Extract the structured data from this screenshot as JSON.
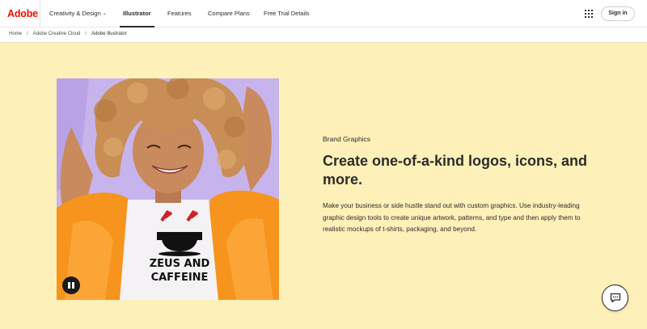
{
  "header": {
    "logo": "Adobe",
    "nav": [
      {
        "label": "Creativity & Design",
        "has_dropdown": true
      },
      {
        "label": "Illustrator",
        "active": true
      },
      {
        "label": "Features"
      },
      {
        "label": "Compare Plans"
      },
      {
        "label": "Free Trial Details"
      }
    ],
    "apps_icon": "grid-icon",
    "signin_label": "Sign in"
  },
  "breadcrumb": {
    "items": [
      "Home",
      "Adobe Creative Cloud",
      "Adobe Illustrator"
    ],
    "separator": "/"
  },
  "hero": {
    "eyebrow": "Brand Graphics",
    "headline": "Create one-of-a-kind logos, icons, and more.",
    "body": "Make your business or side hustle stand out with custom graphics. Use industry-leading graphic design tools to create unique artwork, patterns, and type and then apply them to realistic mockups of t-shirts, packaging, and beyond.",
    "shirt_text_line1": "ZEUS AND",
    "shirt_text_line2": "CAFFEINE",
    "pause_icon": "pause-icon",
    "chat_icon": "chat-icon"
  },
  "colors": {
    "brand": "#eb1000",
    "hero_bg": "#fdf0b8",
    "photo_bg": "#c9b6ec",
    "jacket": "#f7941d"
  }
}
